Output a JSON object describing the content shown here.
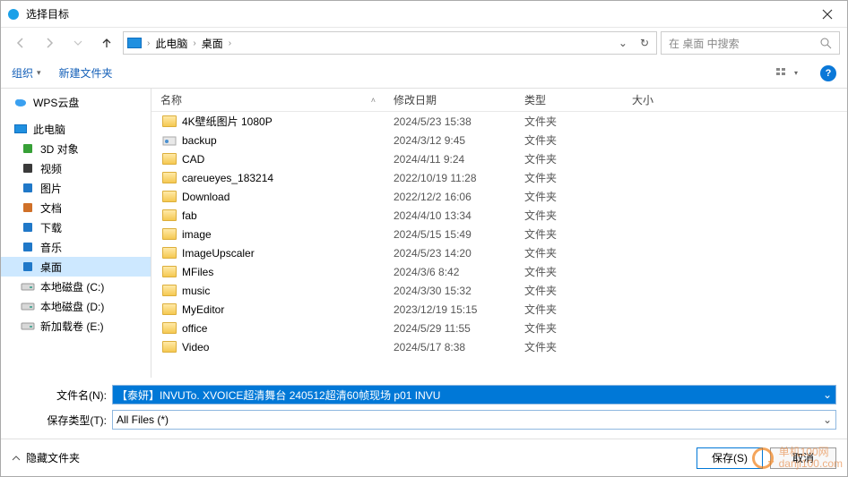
{
  "window": {
    "title": "选择目标"
  },
  "address": {
    "crumb1": "此电脑",
    "crumb2": "桌面",
    "sep": "›"
  },
  "search": {
    "placeholder": "在 桌面 中搜索"
  },
  "toolbar": {
    "organize": "组织",
    "newfolder": "新建文件夹"
  },
  "columns": {
    "name": "名称",
    "date": "修改日期",
    "type": "类型",
    "size": "大小"
  },
  "sidebar": {
    "wps": "WPS云盘",
    "thispc": "此电脑",
    "items": [
      {
        "label": "3D 对象",
        "color": "#37a037"
      },
      {
        "label": "视频",
        "color": "#3a3a3a"
      },
      {
        "label": "图片",
        "color": "#2078c8"
      },
      {
        "label": "文档",
        "color": "#d07028"
      },
      {
        "label": "下载",
        "color": "#2078c8"
      },
      {
        "label": "音乐",
        "color": "#2078c8"
      },
      {
        "label": "桌面",
        "color": "#2078c8",
        "selected": true
      },
      {
        "label": "本地磁盘 (C:)",
        "disk": true
      },
      {
        "label": "本地磁盘 (D:)",
        "disk": true
      },
      {
        "label": "新加载卷 (E:)",
        "disk": true
      }
    ]
  },
  "files": [
    {
      "name": "4K壁纸图片 1080P",
      "date": "2024/5/23 15:38",
      "type": "文件夹"
    },
    {
      "name": "backup",
      "date": "2024/3/12 9:45",
      "type": "文件夹",
      "icon": "special"
    },
    {
      "name": "CAD",
      "date": "2024/4/11 9:24",
      "type": "文件夹"
    },
    {
      "name": "careueyes_183214",
      "date": "2022/10/19 11:28",
      "type": "文件夹"
    },
    {
      "name": "Download",
      "date": "2022/12/2 16:06",
      "type": "文件夹"
    },
    {
      "name": "fab",
      "date": "2024/4/10 13:34",
      "type": "文件夹"
    },
    {
      "name": "image",
      "date": "2024/5/15 15:49",
      "type": "文件夹"
    },
    {
      "name": "ImageUpscaler",
      "date": "2024/5/23 14:20",
      "type": "文件夹"
    },
    {
      "name": "MFiles",
      "date": "2024/3/6 8:42",
      "type": "文件夹"
    },
    {
      "name": "music",
      "date": "2024/3/30 15:32",
      "type": "文件夹"
    },
    {
      "name": "MyEditor",
      "date": "2023/12/19 15:15",
      "type": "文件夹"
    },
    {
      "name": "office",
      "date": "2024/5/29 11:55",
      "type": "文件夹"
    },
    {
      "name": "Video",
      "date": "2024/5/17 8:38",
      "type": "文件夹"
    }
  ],
  "form": {
    "filename_label": "文件名(N):",
    "filename_value": "【泰妍】INVUTo. XVOICE超清舞台 240512超清60帧现场 p01 INVU",
    "filetype_label": "保存类型(T):",
    "filetype_value": "All Files  (*)"
  },
  "footer": {
    "hide": "隐藏文件夹",
    "save": "保存(S)",
    "cancel": "取消"
  },
  "watermark": {
    "line1": "单机100网",
    "line2": "danji100.com"
  }
}
